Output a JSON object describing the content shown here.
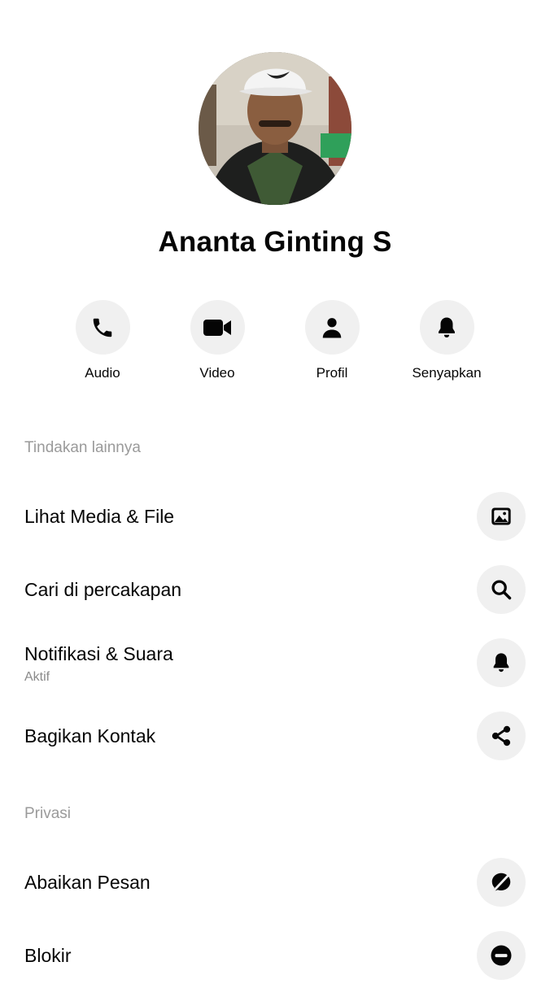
{
  "profile": {
    "name": "Ananta Ginting S"
  },
  "actions": [
    {
      "label": "Audio",
      "icon": "phone-icon"
    },
    {
      "label": "Video",
      "icon": "video-camera-icon"
    },
    {
      "label": "Profil",
      "icon": "person-icon"
    },
    {
      "label": "Senyapkan",
      "icon": "bell-icon"
    }
  ],
  "more_actions": {
    "title": "Tindakan lainnya",
    "items": [
      {
        "label": "Lihat Media & File",
        "icon": "image-icon"
      },
      {
        "label": "Cari di percakapan",
        "icon": "search-icon"
      },
      {
        "label": "Notifikasi & Suara",
        "sublabel": "Aktif",
        "icon": "bell-icon"
      },
      {
        "label": "Bagikan Kontak",
        "icon": "share-icon"
      }
    ]
  },
  "privacy": {
    "title": "Privasi",
    "items": [
      {
        "label": "Abaikan Pesan",
        "icon": "ignore-icon"
      },
      {
        "label": "Blokir",
        "icon": "block-icon"
      }
    ]
  },
  "colors": {
    "text": "#050505",
    "muted": "#9a9a9a",
    "button_bg": "#f0f0f0"
  }
}
